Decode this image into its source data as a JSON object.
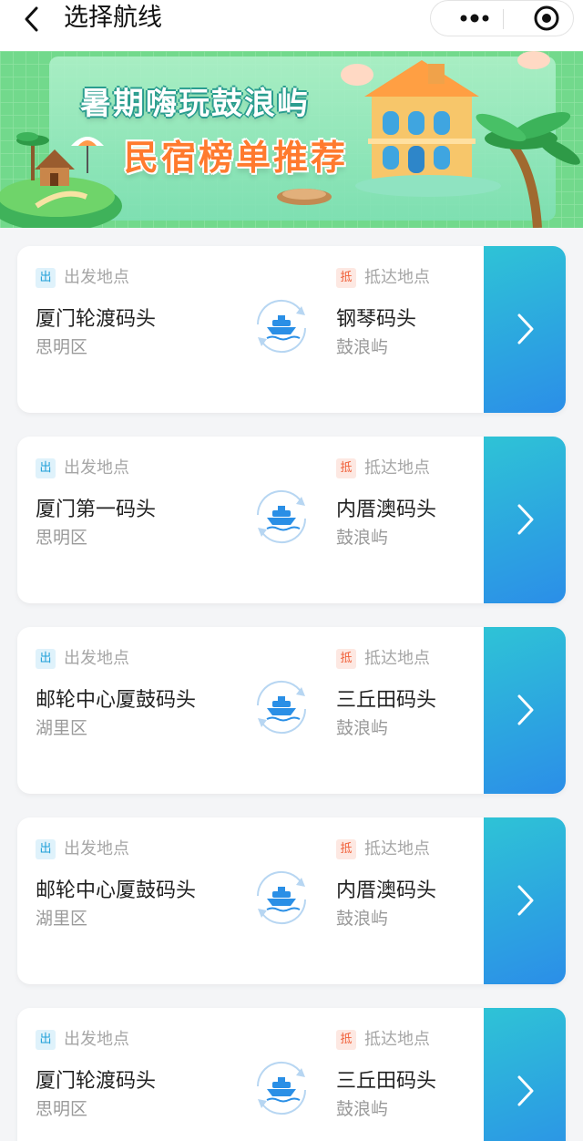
{
  "header": {
    "title": "选择航线",
    "back_icon": "chevron-left-icon",
    "more_icon": "more-dots-icon",
    "close_icon": "target-circle-icon"
  },
  "banner": {
    "line1": "暑期嗨玩鼓浪屿",
    "line2": "民宿榜单推荐"
  },
  "labels": {
    "departure_tag": "出",
    "departure_caption": "出发地点",
    "arrival_tag": "抵",
    "arrival_caption": "抵达地点"
  },
  "routes": [
    {
      "from": "厦门轮渡码头",
      "from_district": "思明区",
      "to": "钢琴码头",
      "to_district": "鼓浪屿"
    },
    {
      "from": "厦门第一码头",
      "from_district": "思明区",
      "to": "内厝澳码头",
      "to_district": "鼓浪屿"
    },
    {
      "from": "邮轮中心厦鼓码头",
      "from_district": "湖里区",
      "to": "三丘田码头",
      "to_district": "鼓浪屿"
    },
    {
      "from": "邮轮中心厦鼓码头",
      "from_district": "湖里区",
      "to": "内厝澳码头",
      "to_district": "鼓浪屿"
    },
    {
      "from": "厦门轮渡码头",
      "from_district": "思明区",
      "to": "三丘田码头",
      "to_district": "鼓浪屿"
    }
  ],
  "colors": {
    "accent_start": "#2ec3d6",
    "accent_end": "#2b8ee8",
    "ship_icon": "#2a8fe6",
    "departure_tag": "#21a0d8",
    "arrival_tag": "#f0603a"
  }
}
